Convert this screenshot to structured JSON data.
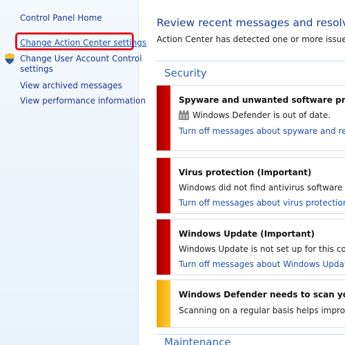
{
  "sidebar": {
    "home": "Control Panel Home",
    "settings": "Change Action Center settings",
    "uac_line1": "Change User Account Control",
    "uac_line2": "settings",
    "archived": "View archived messages",
    "performance": "View performance information"
  },
  "main": {
    "title": "Review recent messages and resolve p",
    "description": "Action Center has detected one or more issues for y",
    "security_label": "Security",
    "maintenance_label": "Maintenance",
    "cards": [
      {
        "title": "Spyware and unwanted software protection",
        "text": "Windows Defender is out of date.",
        "link": "Turn off messages about spyware and related"
      },
      {
        "title": "Virus protection  (Important)",
        "text": "Windows did not find antivirus software on th",
        "link": "Turn off messages about virus protection"
      },
      {
        "title": "Windows Update  (Important)",
        "text": "Windows Update is not set up for this compu",
        "link": "Turn off messages about Windows Update"
      },
      {
        "title": "Windows Defender needs to scan your com",
        "text": "Scanning on a regular basis helps improve the"
      }
    ]
  },
  "colors": {
    "critical": "#c00000",
    "warning": "#f5b800",
    "link": "#1e50a8",
    "highlight": "#e8121b"
  }
}
